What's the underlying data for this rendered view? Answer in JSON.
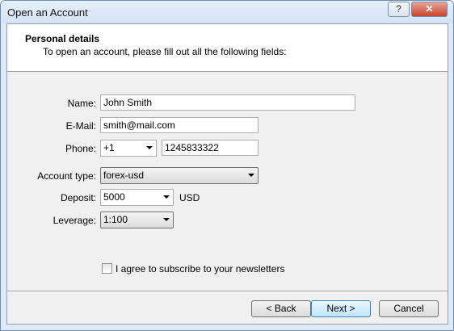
{
  "window": {
    "title": "Open an Account",
    "help_label": "?",
    "close_label": "✕"
  },
  "header": {
    "title": "Personal details",
    "subtitle": "To open an account, please fill out all the following fields:"
  },
  "form": {
    "name_label": "Name:",
    "name_value": "John Smith",
    "email_label": "E-Mail:",
    "email_value": "smith@mail.com",
    "phone_label": "Phone:",
    "phone_code": "+1",
    "phone_number": "1245833322",
    "account_type_label": "Account type:",
    "account_type_value": "forex-usd",
    "deposit_label": "Deposit:",
    "deposit_value": "5000",
    "deposit_currency": "USD",
    "leverage_label": "Leverage:",
    "leverage_value": "1:100",
    "newsletter_label": "I agree to subscribe to your newsletters",
    "newsletter_checked": false
  },
  "buttons": {
    "back": "< Back",
    "next": "Next >",
    "cancel": "Cancel"
  }
}
